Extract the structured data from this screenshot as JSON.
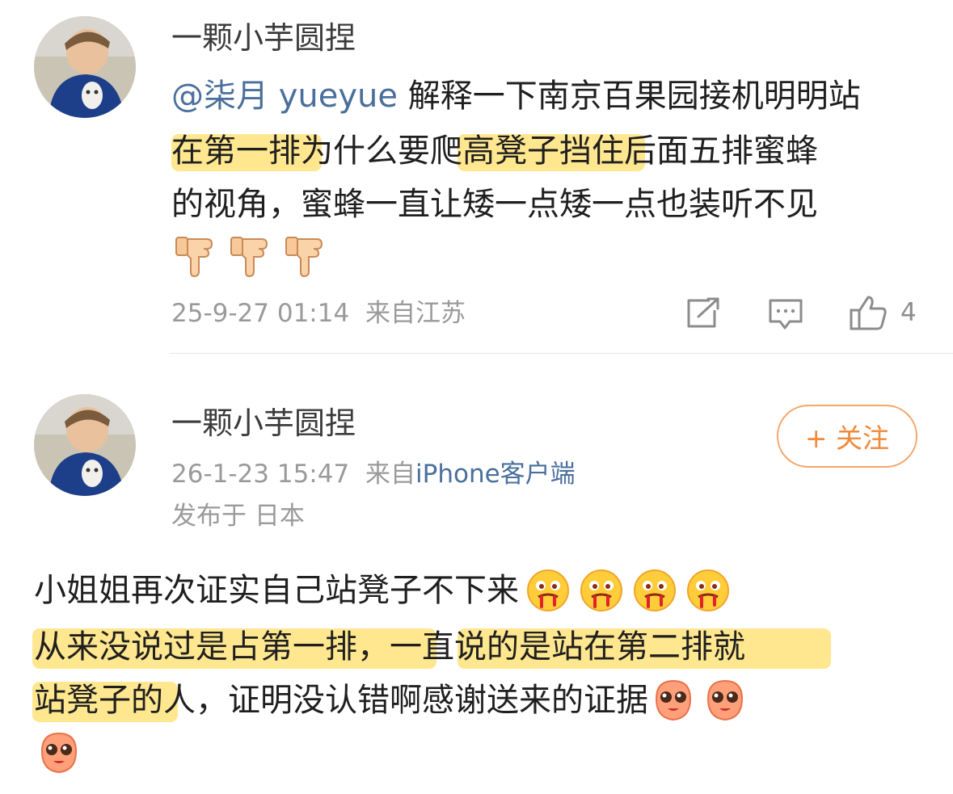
{
  "comment1": {
    "username": "一颗小芋圆捏",
    "mention": "@柒月 yueyue",
    "line1_rest": " 解释一下南京百果园接机明明站",
    "line2": "在第一排为什么要爬高凳子挡住后面五排蜜蜂",
    "line3": "的视角，蜜蜂一直让矮一点矮一点也装听不见",
    "emoji_icons": [
      "thumbs-down-emoji",
      "thumbs-down-emoji",
      "thumbs-down-emoji"
    ],
    "time": "25-9-27 01:14",
    "location": "来自江苏",
    "like_count": "4"
  },
  "comment2": {
    "username": "一颗小芋圆捏",
    "follow_label": "+ 关注",
    "time": "26-1-23 15:47",
    "source_prefix": "来自",
    "source_device": "iPhone客户端",
    "published_in": "发布于 日本",
    "line1": "小姐姐再次证实自己站凳子不下来",
    "line2": "从来没说过是占第一排，一直说的是站在第二排就",
    "line3": "站凳子的人，证明没认错啊感谢送来的证据",
    "line1_emojis": [
      "drooling-emoji",
      "drooling-emoji",
      "drooling-emoji",
      "drooling-emoji"
    ],
    "line3_emojis": [
      "sparkle-eyes-emoji",
      "sparkle-eyes-emoji",
      "sparkle-eyes-emoji"
    ]
  },
  "colors": {
    "highlight": "#ffd84a",
    "link": "#4a6f9c",
    "follow": "#f08a3c",
    "meta": "#9a9a9a"
  }
}
